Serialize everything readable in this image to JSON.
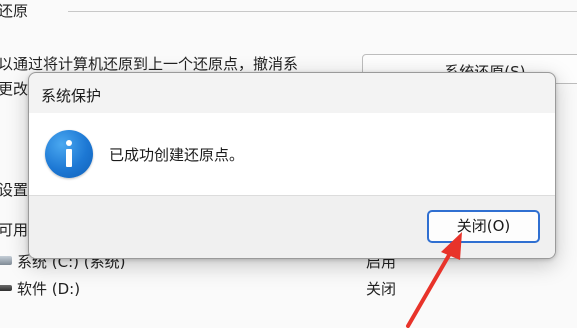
{
  "background": {
    "section_title": "还原",
    "description_line1": "以通过将计算机还原到上一个还原点，撤消系",
    "description_line2": "更改",
    "restore_button": "系统还原(S)...",
    "settings_label": "设置",
    "available_label": "可用",
    "drives": [
      {
        "name": "系统 (C:) (系统)",
        "status": "启用"
      },
      {
        "name": "软件 (D:)",
        "status": "关闭"
      }
    ]
  },
  "dialog": {
    "title": "系统保护",
    "message": "已成功创建还原点。",
    "close_button": "关闭(O)",
    "icon": "info-icon"
  },
  "annotation": {
    "arrow_color": "#e8332a"
  }
}
